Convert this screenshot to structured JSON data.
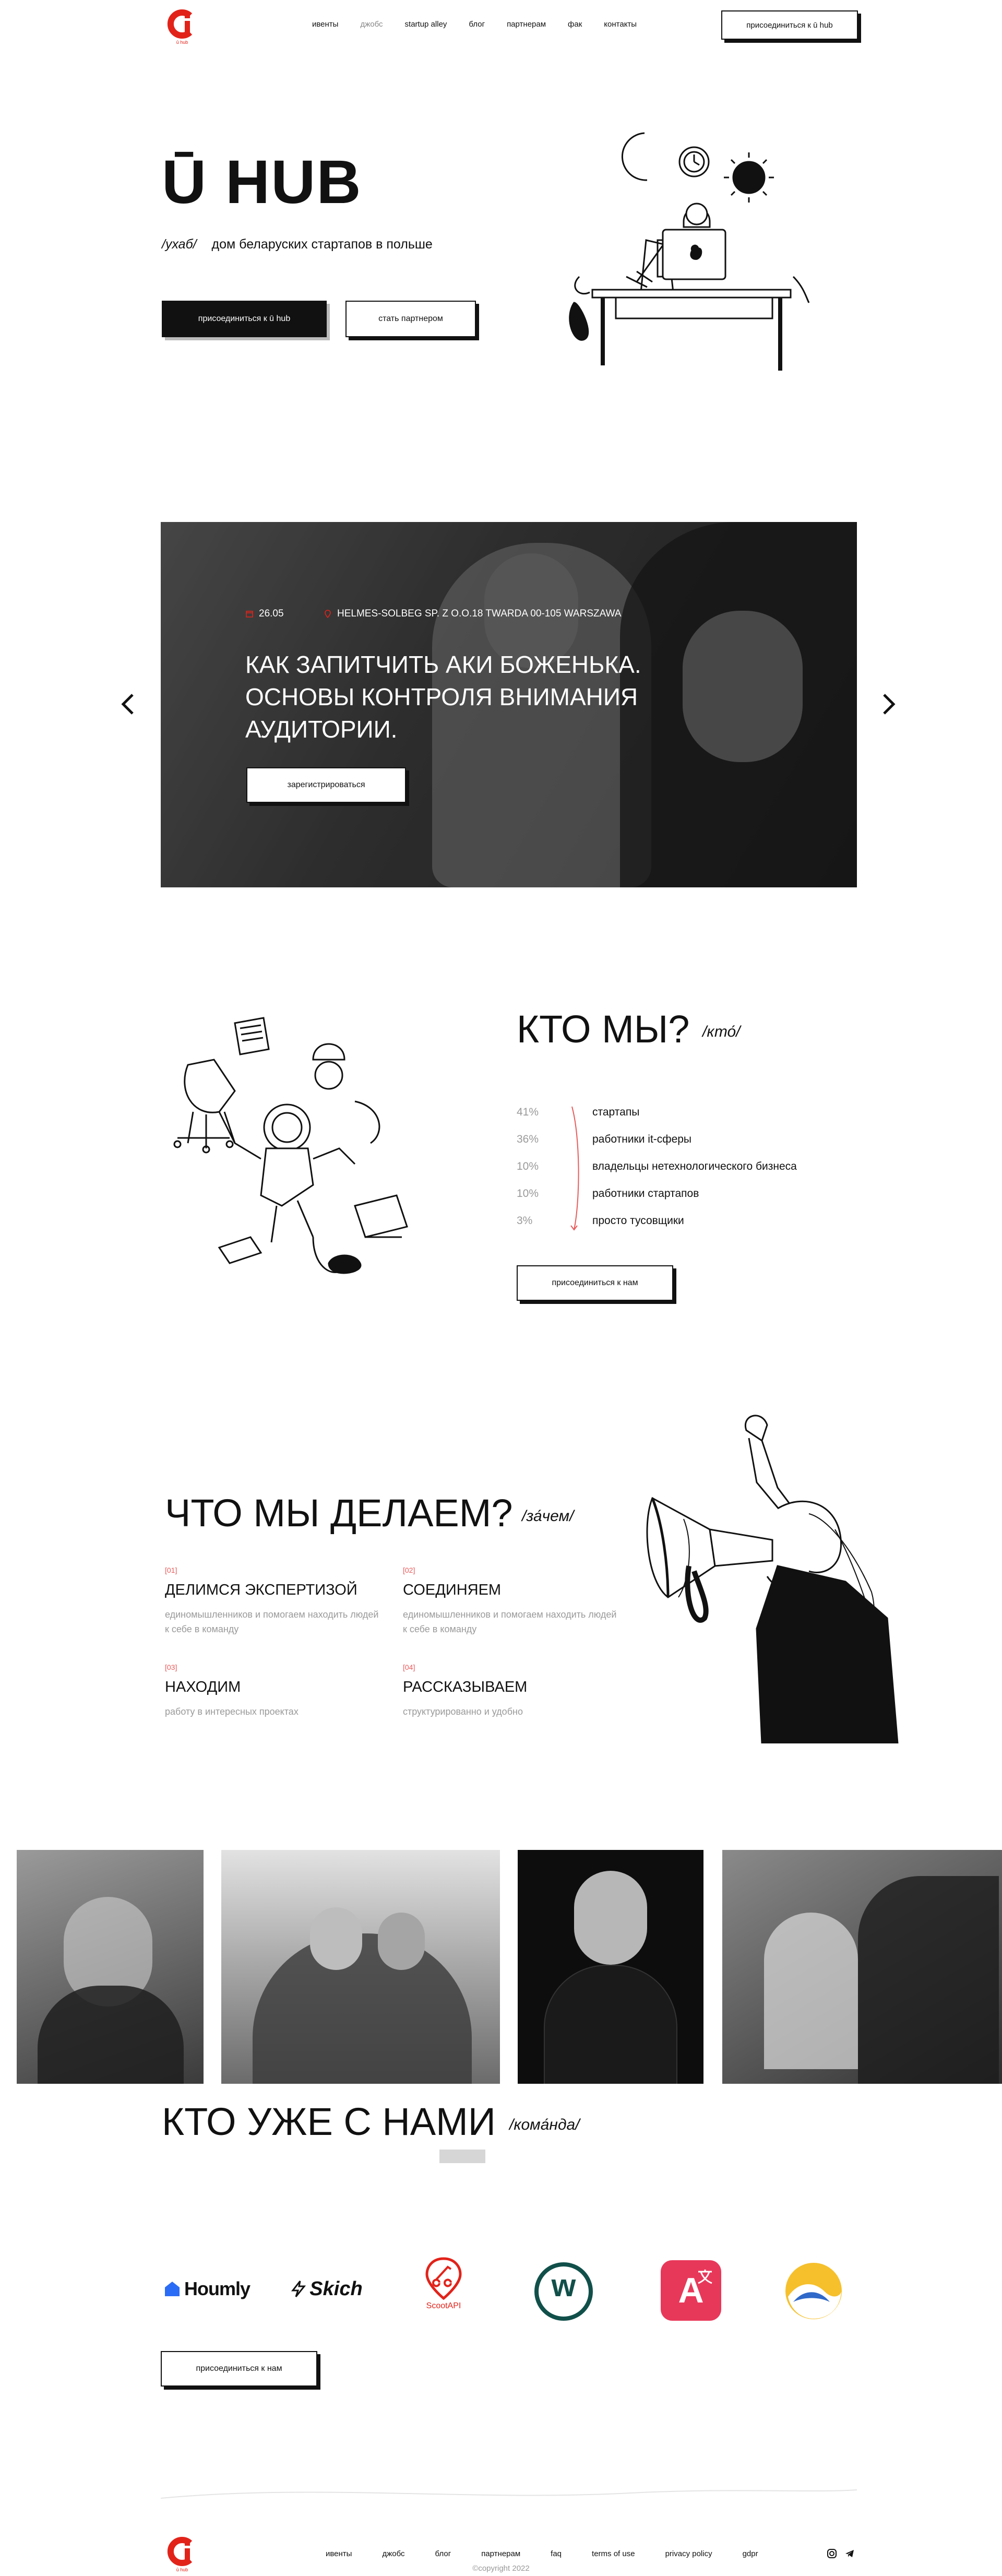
{
  "header": {
    "logo_text": "ū hub",
    "nav": [
      "ивенты",
      "джобс",
      "startup alley",
      "блог",
      "партнерам",
      "фак",
      "контакты"
    ],
    "cta": "присоединиться к ū hub"
  },
  "hero": {
    "title": "Ū HUB",
    "transcription": "/ухаб/",
    "subtitle": "дом беларуских стартапов в польше",
    "btn_join": "присоединиться к ū hub",
    "btn_partner": "стать партнером"
  },
  "event": {
    "date": "26.05",
    "location": "HELMES-SOLBEG SP. Z O.O.18 TWARDA 00-105 WARSZAWA",
    "title": "КАК ЗАПИТЧИТЬ АКИ БОЖЕНЬКА. ОСНОВЫ КОНТРОЛЯ ВНИМАНИЯ АУДИТОРИИ.",
    "cta": "зарегистрироваться"
  },
  "who": {
    "title": "КТО МЫ?",
    "aside": "/кто́/",
    "stats": [
      {
        "pct": "41%",
        "label": "стартапы"
      },
      {
        "pct": "36%",
        "label": "работники it-сферы"
      },
      {
        "pct": "10%",
        "label": "владельцы нетехнологического бизнеса"
      },
      {
        "pct": "10%",
        "label": "работники стартапов"
      },
      {
        "pct": "3%",
        "label": "просто тусовщики"
      }
    ],
    "cta": "присоединиться к нам"
  },
  "what": {
    "title": "ЧТО МЫ ДЕЛАЕМ?",
    "aside": "/за́чем/",
    "items": [
      {
        "num": "[01]",
        "title": "ДЕЛИМСЯ ЭКСПЕРТИЗОЙ",
        "desc": "единомышленников и помогаем находить людей к себе в команду"
      },
      {
        "num": "[02]",
        "title": "СОЕДИНЯЕМ",
        "desc": "единомышленников и помогаем находить людей к себе в команду"
      },
      {
        "num": "[03]",
        "title": "НАХОДИМ",
        "desc": "работу в интересных проектах"
      },
      {
        "num": "[04]",
        "title": "РАССКАЗЫВАЕМ",
        "desc": "структурированно и удобно"
      }
    ]
  },
  "partners": {
    "title": "КТО УЖЕ С НАМИ",
    "aside": "/кома́нда/",
    "logos": [
      "Houmly",
      "Skich",
      "ScootAPI",
      "w",
      "A",
      ""
    ],
    "cta": "присоединиться к нам"
  },
  "footer": {
    "nav": [
      "ивенты",
      "джобс",
      "блог",
      "партнерам",
      "faq",
      "terms of use",
      "privacy policy",
      "gdpr"
    ],
    "copyright": "©copyright 2022"
  },
  "colors": {
    "accent": "#e2231a",
    "dark": "#111111",
    "muted": "#9a9a9a"
  }
}
